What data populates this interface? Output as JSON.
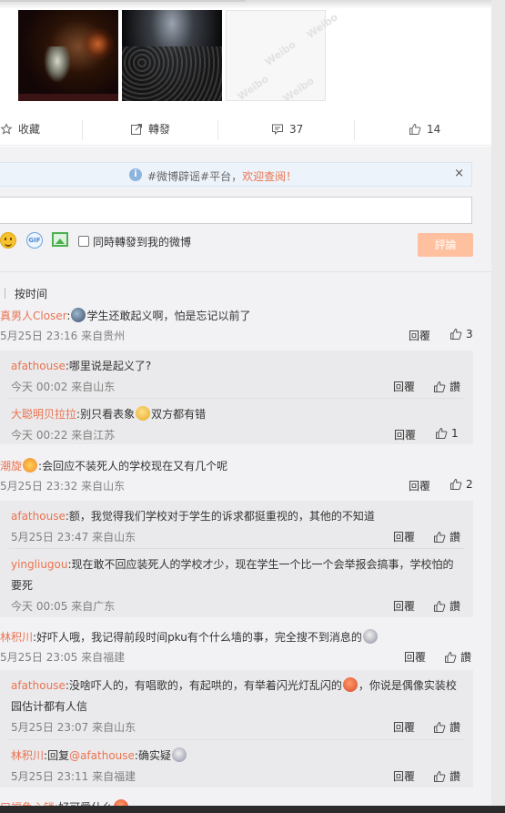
{
  "actions": {
    "favorite": "收藏",
    "repost": "轉發",
    "comment_count": "37",
    "like_count": "14"
  },
  "notice": {
    "prefix": "#微博辟谣#平台，",
    "highlight": "欢迎查阅！",
    "close": "×"
  },
  "compose": {
    "repost_label": "同時轉發到我的微博",
    "submit": "評論",
    "gif_text": "GIF"
  },
  "sort": {
    "label": "按时间"
  },
  "reply_label": "回覆",
  "zan_label": "讚",
  "comments": [
    {
      "name": "真男人Closer",
      "text": "学生还敢起义啊，怕是忘记以前了",
      "meta": "5月25日 23:16 来自贵州",
      "likes": "3",
      "replies": [
        {
          "name": "afathouse",
          "text": "哪里说是起义了?",
          "meta": "今天 00:02 来自山东",
          "likes": "讚"
        },
        {
          "name": "大聪明贝拉拉",
          "text": "别只看表象",
          "text2": "双方都有错",
          "meta": "今天 00:22 来自江苏",
          "likes": "1"
        }
      ]
    },
    {
      "name": "潮旋",
      "text": "会回应不装死人的学校现在又有几个呢",
      "meta": "5月25日 23:32 来自山东",
      "likes": "2",
      "replies": [
        {
          "name": "afathouse",
          "text": "额，我觉得我们学校对于学生的诉求都挺重视的，其他的不知道",
          "meta": "5月25日 23:47 来自山东",
          "likes": "讚"
        },
        {
          "name": "yingliugou",
          "text": "现在敢不回应装死人的学校才少，现在学生一个比一个会举报会搞事，学校怕的",
          "text2": "要死",
          "meta": "今天 00:05 来自广东",
          "likes": "讚"
        }
      ]
    },
    {
      "name": "林积川",
      "text": "好吓人哦，我记得前段时间pku有个什么墙的事，完全搜不到消息的",
      "meta": "5月25日 23:05 来自福建",
      "likes": "讚",
      "replies": [
        {
          "name": "afathouse",
          "text": "没啥吓人的，有唱歌的，有起哄的，有举着闪光灯乱闪的",
          "text_after": "，你说是偶像实装校",
          "text2": "园估计都有人信",
          "meta": "5月25日 23:07 来自山东",
          "likes": "讚"
        },
        {
          "name": "林积川",
          "prefix": "回复",
          "mention": "@afathouse",
          "text": ":确实疑",
          "meta": "5月25日 23:11 来自福建",
          "likes": "讚"
        }
      ]
    },
    {
      "name": "口福鱼心锁",
      "text": "好可爱什么"
    }
  ]
}
